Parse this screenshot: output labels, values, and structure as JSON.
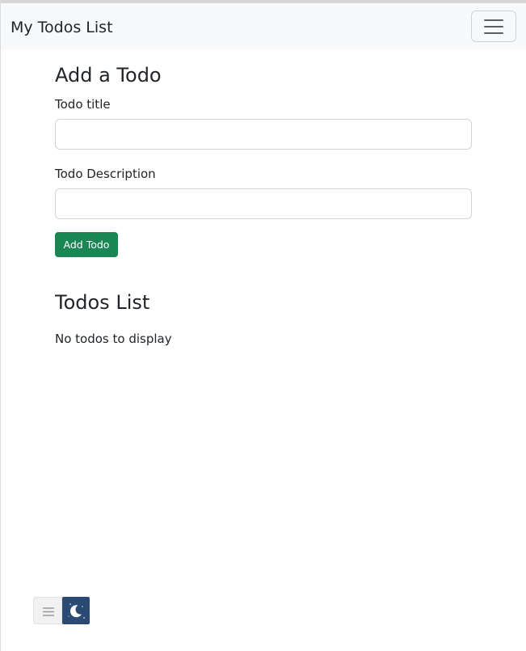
{
  "navbar": {
    "brand": "My Todos List",
    "toggler_icon": "hamburger-menu-icon"
  },
  "add_form": {
    "heading": "Add a Todo",
    "title_label": "Todo title",
    "title_value": "",
    "description_label": "Todo Description",
    "description_value": "",
    "submit_label": "Add Todo"
  },
  "todos": {
    "heading": "Todos List",
    "empty_message": "No todos to display",
    "items": []
  },
  "widget": {
    "menu_icon": "menu-lines-icon",
    "theme_icon": "moon-stars-icon"
  },
  "colors": {
    "navbar_bg": "#f8f9fa",
    "button_success": "#198754",
    "theme_toggle_bg": "#2b4a73"
  }
}
